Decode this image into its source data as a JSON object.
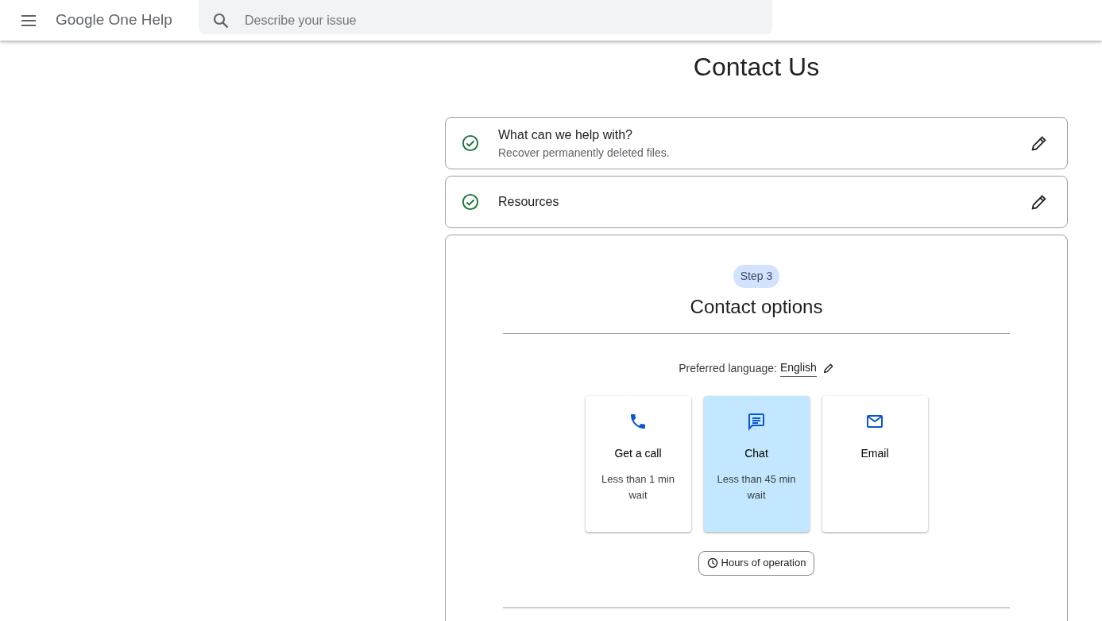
{
  "header": {
    "title": "Google One Help",
    "search": {
      "placeholder": "Describe your issue"
    }
  },
  "page_title": "Contact Us",
  "steps": [
    {
      "title": "What can we help with?",
      "subtitle": "Recover permanently deleted files.",
      "completed": true
    },
    {
      "title": "Resources",
      "completed": true
    }
  ],
  "contact_step": {
    "badge": "Step 3",
    "title": "Contact options",
    "language_label": "Preferred language:",
    "language": "English",
    "options": [
      {
        "kind": "phone",
        "label": "Get a call",
        "wait": "Less than 1 min wait",
        "selected": false
      },
      {
        "kind": "chat",
        "label": "Chat",
        "wait": "Less than 45 min wait",
        "selected": true
      },
      {
        "kind": "email",
        "label": "Email",
        "selected": false
      }
    ],
    "hours_button": "Hours of operation"
  }
}
